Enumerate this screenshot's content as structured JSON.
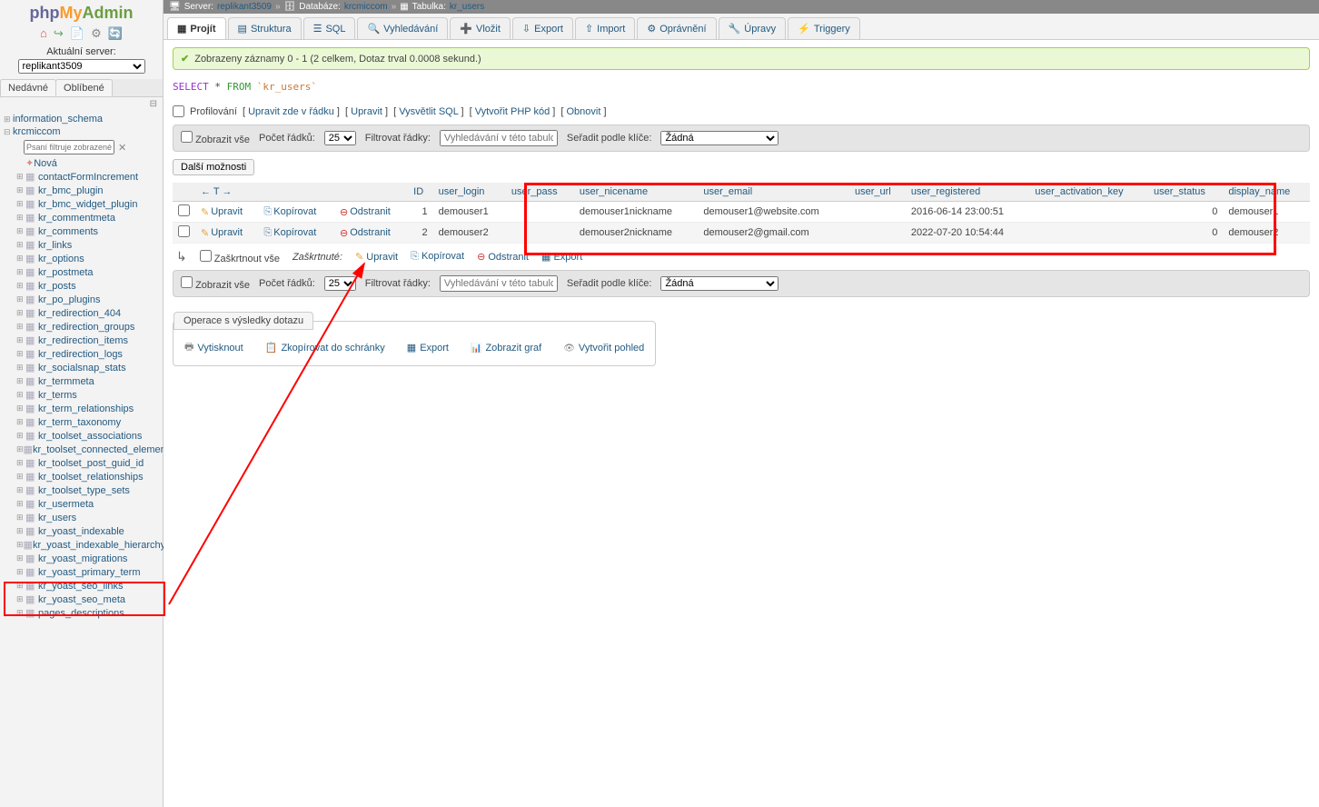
{
  "logo": {
    "part1": "php",
    "part2": "My",
    "part3": "Admin"
  },
  "sidebar": {
    "server_label": "Aktuální server:",
    "server_value": "replikant3509",
    "tabs": {
      "recent": "Nedávné",
      "favorites": "Oblíbené"
    },
    "filter_placeholder": "Psaní filtruje zobrazené, Ente",
    "new_label": "Nová",
    "dbs": [
      {
        "name": "information_schema"
      },
      {
        "name": "krcmiccom"
      }
    ],
    "tables": [
      "contactFormIncrement",
      "kr_bmc_plugin",
      "kr_bmc_widget_plugin",
      "kr_commentmeta",
      "kr_comments",
      "kr_links",
      "kr_options",
      "kr_postmeta",
      "kr_posts",
      "kr_po_plugins",
      "kr_redirection_404",
      "kr_redirection_groups",
      "kr_redirection_items",
      "kr_redirection_logs",
      "kr_socialsnap_stats",
      "kr_termmeta",
      "kr_terms",
      "kr_term_relationships",
      "kr_term_taxonomy",
      "kr_toolset_associations",
      "kr_toolset_connected_elements",
      "kr_toolset_post_guid_id",
      "kr_toolset_relationships",
      "kr_toolset_type_sets",
      "kr_usermeta",
      "kr_users",
      "kr_yoast_indexable",
      "kr_yoast_indexable_hierarchy",
      "kr_yoast_migrations",
      "kr_yoast_primary_term",
      "kr_yoast_seo_links",
      "kr_yoast_seo_meta",
      "pages_descriptions"
    ]
  },
  "breadcrumb": {
    "server_pre": "Server:",
    "server": "replikant3509",
    "db_pre": "Databáze:",
    "db": "krcmiccom",
    "table_pre": "Tabulka:",
    "table": "kr_users"
  },
  "topmenu": [
    {
      "icon": "▦",
      "label": "Projít",
      "active": true
    },
    {
      "icon": "▤",
      "label": "Struktura"
    },
    {
      "icon": "☰",
      "label": "SQL"
    },
    {
      "icon": "🔍",
      "label": "Vyhledávání"
    },
    {
      "icon": "➕",
      "label": "Vložit"
    },
    {
      "icon": "⇩",
      "label": "Export"
    },
    {
      "icon": "⇧",
      "label": "Import"
    },
    {
      "icon": "⚙",
      "label": "Oprávnění"
    },
    {
      "icon": "🔧",
      "label": "Úpravy"
    },
    {
      "icon": "⚡",
      "label": "Triggery"
    }
  ],
  "success": "Zobrazeny záznamy 0 - 1 (2 celkem, Dotaz trval 0.0008 sekund.)",
  "sql": {
    "select": "SELECT",
    "star": "*",
    "from": "FROM",
    "tbl": "`kr_users`"
  },
  "links": {
    "profiling": "Profilování",
    "edit_inline": "Upravit zde v řádku",
    "edit": "Upravit",
    "explain": "Vysvětlit SQL",
    "php": "Vytvořit PHP kód",
    "refresh": "Obnovit"
  },
  "controls": {
    "show_all": "Zobrazit vše",
    "rows_label": "Počet řádků:",
    "rows_value": "25",
    "filter_label": "Filtrovat řádky:",
    "filter_placeholder": "Vyhledávání v této tabulce",
    "sort_label": "Seřadit podle klíče:",
    "sort_value": "Žádná",
    "more_options": "Další možnosti"
  },
  "table": {
    "headers": [
      "ID",
      "user_login",
      "user_pass",
      "user_nicename",
      "user_email",
      "user_url",
      "user_registered",
      "user_activation_key",
      "user_status",
      "display_name"
    ],
    "action_edit": "Upravit",
    "action_copy": "Kopírovat",
    "action_delete": "Odstranit",
    "rows": [
      {
        "id": "1",
        "login": "demouser1",
        "pass": "",
        "nicename": "demouser1nickname",
        "email": "demouser1@website.com",
        "url": "",
        "registered": "2016-06-14 23:00:51",
        "key": "",
        "status": "0",
        "display": "demouser1"
      },
      {
        "id": "2",
        "login": "demouser2",
        "pass": "",
        "nicename": "demouser2nickname",
        "email": "demouser2@gmail.com",
        "url": "",
        "registered": "2022-07-20 10:54:44",
        "key": "",
        "status": "0",
        "display": "demouser2"
      }
    ]
  },
  "checkbar": {
    "check_all": "Zaškrtnout vše",
    "with_selected": "Zaškrtnuté:",
    "edit": "Upravit",
    "copy": "Kopírovat",
    "delete": "Odstranit",
    "export": "Export"
  },
  "ops": {
    "legend": "Operace s výsledky dotazu",
    "print": "Vytisknout",
    "clipboard": "Zkopírovat do schránky",
    "export": "Export",
    "chart": "Zobrazit graf",
    "view": "Vytvořit pohled"
  }
}
